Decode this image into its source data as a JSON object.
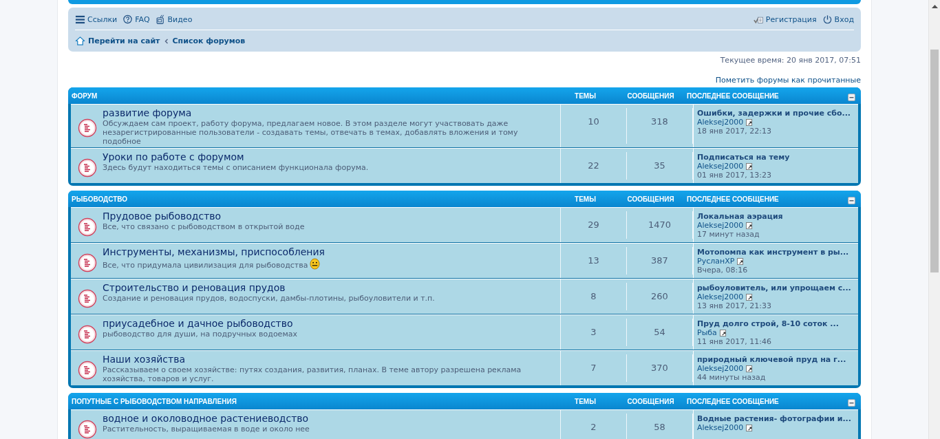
{
  "navbar": {
    "links_left": [
      {
        "label": "Ссылки",
        "kind": "menu"
      },
      {
        "label": "FAQ",
        "kind": "faq"
      },
      {
        "label": "Видео",
        "kind": "tv"
      }
    ],
    "links_right": [
      {
        "label": "Регистрация",
        "kind": "register"
      },
      {
        "label": "Вход",
        "kind": "power"
      }
    ],
    "breadcrumbs": [
      "Перейти на сайт",
      "Список форумов"
    ]
  },
  "current_time": "Текущее время: 20 янв 2017, 07:51",
  "mark_read": "Пометить форумы как прочитанные",
  "sections": [
    {
      "title": "ФОРУМ",
      "col_topics": "ТЕМЫ",
      "col_posts": "СООБЩЕНИЯ",
      "col_last": "ПОСЛЕДНЕЕ СООБЩЕНИЕ",
      "rows": [
        {
          "name": "развитие форума",
          "description": "Обсуждаем сам проект, работу форума, предлагаем новое. В этом разделе могут участвовать даже незарегистрированные пользователи - создавать темы, отвечать в темах, добавлять вложения и тому подобное",
          "emoticon": false,
          "topics": "10",
          "posts": "318",
          "last_title": "Ошибки, задержки и прочие сбо...",
          "last_author": "Aleksej2000",
          "last_date": "18 янв 2017, 22:13"
        },
        {
          "name": "Уроки по работе с форумом",
          "description": "Здесь будут находиться темы с описанием функционала форума.",
          "emoticon": false,
          "topics": "22",
          "posts": "35",
          "last_title": "Подписаться на тему",
          "last_author": "Aleksej2000",
          "last_date": "01 янв 2017, 13:23"
        }
      ]
    },
    {
      "title": "РЫБОВОДСТВО",
      "col_topics": "ТЕМЫ",
      "col_posts": "СООБЩЕНИЯ",
      "col_last": "ПОСЛЕДНЕЕ СООБЩЕНИЕ",
      "rows": [
        {
          "name": "Прудовое рыбоводство",
          "description": "Все, что связано с рыбоводством в открытой воде",
          "emoticon": false,
          "topics": "29",
          "posts": "1470",
          "last_title": "Локальная аэрация",
          "last_author": "Aleksej2000",
          "last_date": "17 минут назад"
        },
        {
          "name": "Инструменты, механизмы, приспособления",
          "description": "Все, что придумала цивилизация для рыбоводства",
          "emoticon": true,
          "topics": "13",
          "posts": "387",
          "last_title": "Мотопомпа как инструмент в ры...",
          "last_author": "РусланXP",
          "last_date": "Вчера, 08:16"
        },
        {
          "name": "Строительство и реновация прудов",
          "description": "Создание и реновация прудов, водоспуски, дамбы-плотины, рыбоуловители и т.п.",
          "emoticon": false,
          "topics": "8",
          "posts": "260",
          "last_title": "рыбоуловитель, или упрощаем с...",
          "last_author": "Aleksej2000",
          "last_date": "13 янв 2017, 21:33"
        },
        {
          "name": "приусадебное и дачное рыбоводство",
          "description": "рыбоводство для души, на подручных водоемах",
          "emoticon": false,
          "topics": "3",
          "posts": "54",
          "last_title": "Пруд долго строй, 8-10 соток ...",
          "last_author": "Рыба",
          "last_date": "11 янв 2017, 11:46"
        },
        {
          "name": "Наши хозяйства",
          "description": "Рассказываем о своем хозяйстве: путях создания, развития, планах. В теме автору разрешена реклама хозяйства, товаров и услуг.",
          "emoticon": false,
          "topics": "7",
          "posts": "370",
          "last_title": "природный ключевой пруд на г...",
          "last_author": "Aleksej2000",
          "last_date": "44 минуты назад"
        }
      ]
    },
    {
      "title": "ПОПУТНЫЕ С РЫБОВОДСТВОМ НАПРАВЛЕНИЯ",
      "col_topics": "ТЕМЫ",
      "col_posts": "СООБЩЕНИЯ",
      "col_last": "ПОСЛЕДНЕЕ СООБЩЕНИЕ",
      "rows": [
        {
          "name": "водное и околоводное растениеводство",
          "description": "Растительность, выращиваемая в воде и около нее",
          "emoticon": false,
          "topics": "2",
          "posts": "58",
          "last_title": "Водные растения- фотографии и...",
          "last_author": "Aleksej2000"
        }
      ]
    }
  ]
}
